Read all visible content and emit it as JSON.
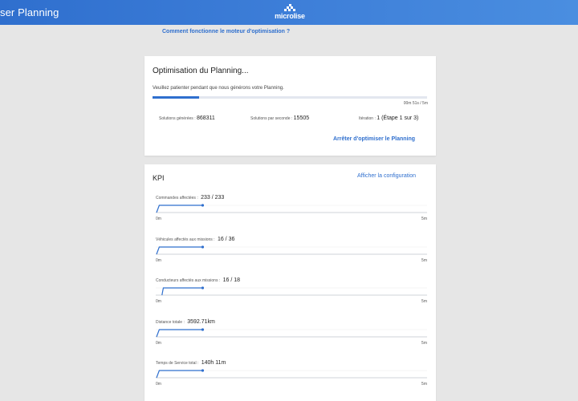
{
  "header": {
    "title": "ser Planning",
    "logo_text": "microlise"
  },
  "help_link": "Comment fonctionne le moteur d'optimisation ?",
  "optimisation": {
    "title": "Optimisation du Planning...",
    "subtitle": "Veuillez patienter pendant que nous générons votre Planning.",
    "elapsed": "00m 51s / 5m",
    "progress": 0.17,
    "stats": [
      {
        "label": "Solutions générées : ",
        "value": "868311"
      },
      {
        "label": "Solutions par seconde : ",
        "value": "15505"
      },
      {
        "label": "Itération : ",
        "value": "1 (Étape 1 sur 3)"
      }
    ],
    "stop_label": "Arrêter d'optimiser le Planning"
  },
  "kpi": {
    "title": "KPI",
    "config_label": "Afficher la configuration",
    "items": [
      {
        "label": "Commandes affectées : ",
        "value": "233 / 233",
        "axis_min": "0m",
        "axis_max": "5m",
        "series": [
          [
            0,
            0.0
          ],
          [
            0.01,
            1.0
          ],
          [
            0.17,
            1.0
          ]
        ]
      },
      {
        "label": "Véhicules affectés aux missions : ",
        "value": "16 / 36",
        "axis_min": "0m",
        "axis_max": "5m",
        "series": [
          [
            0,
            0.0
          ],
          [
            0.01,
            1.0
          ],
          [
            0.17,
            1.0
          ]
        ]
      },
      {
        "label": "Conducteurs affectés aux missions : ",
        "value": "16 / 18",
        "axis_min": "0m",
        "axis_max": "5m",
        "series": [
          [
            0.02,
            0.0
          ],
          [
            0.025,
            1.0
          ],
          [
            0.17,
            1.0
          ]
        ]
      },
      {
        "label": "Distance totale : ",
        "value": "3592.71km",
        "axis_min": "0m",
        "axis_max": "5m",
        "series": [
          [
            0,
            0.0
          ],
          [
            0.01,
            1.0
          ],
          [
            0.17,
            1.0
          ]
        ]
      },
      {
        "label": "Temps de Service total : ",
        "value": "140h 11m",
        "axis_min": "0m",
        "axis_max": "5m",
        "series": [
          [
            0,
            0.0
          ],
          [
            0.01,
            1.0
          ],
          [
            0.17,
            1.0
          ]
        ]
      }
    ]
  },
  "colors": {
    "brand": "#2f6fce",
    "track": "#cfd3da"
  }
}
